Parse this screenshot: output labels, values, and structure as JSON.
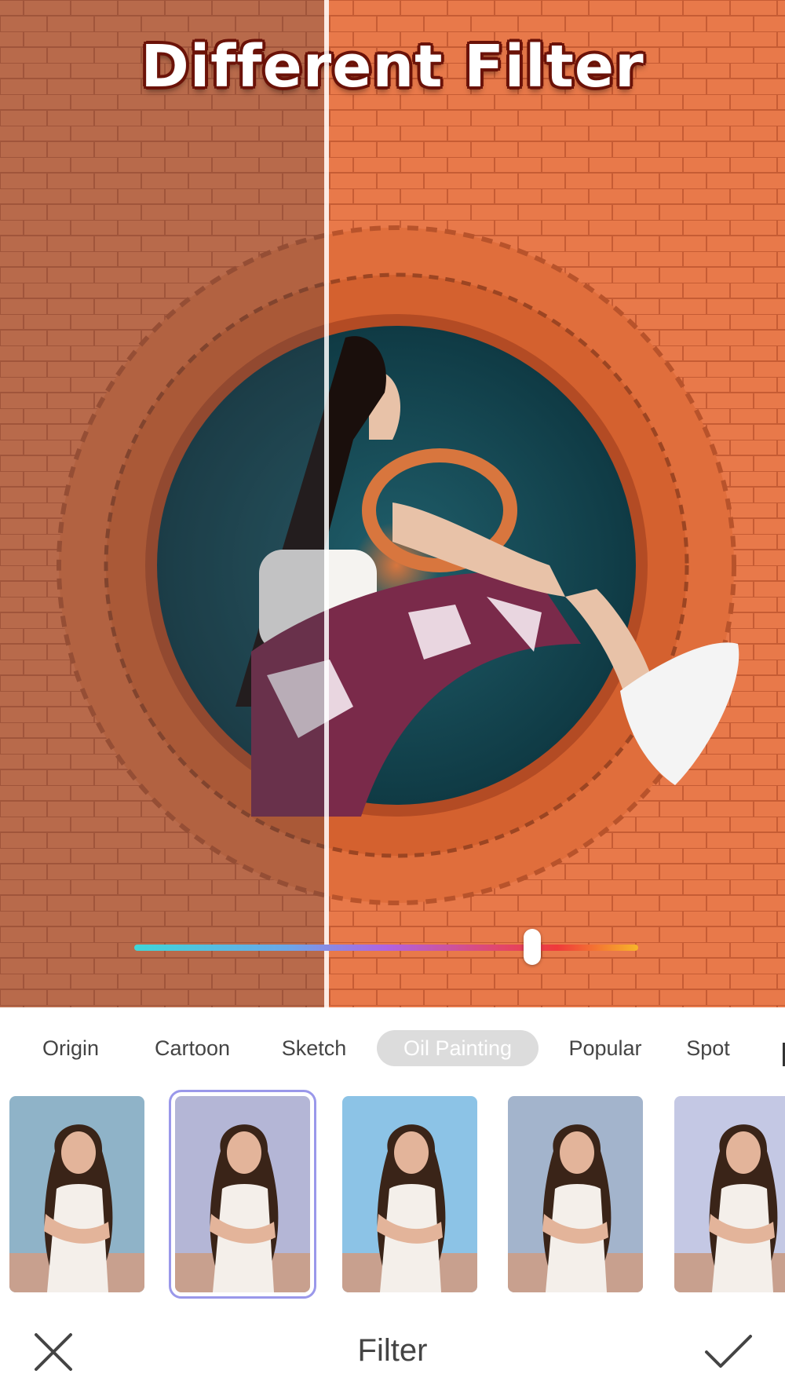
{
  "headline": "Different Filter",
  "slider": {
    "value": 0.79
  },
  "tabs": [
    {
      "label": "Origin",
      "active": false
    },
    {
      "label": "Cartoon",
      "active": false
    },
    {
      "label": "Sketch",
      "active": false
    },
    {
      "label": "Oil Painting",
      "active": true
    },
    {
      "label": "Popular",
      "active": false
    },
    {
      "label": "Spot",
      "active": false
    }
  ],
  "thumbnails": [
    {
      "selected": false,
      "sky": "#8fb3c8"
    },
    {
      "selected": true,
      "sky": "#b4b6d6"
    },
    {
      "selected": false,
      "sky": "#8cc3e6"
    },
    {
      "selected": false,
      "sky": "#a3b4cc"
    },
    {
      "selected": false,
      "sky": "#c4c8e4"
    }
  ],
  "bottom_bar": {
    "title": "Filter",
    "close_icon": "close-icon",
    "confirm_icon": "check-icon"
  },
  "colors": {
    "accent": "#9a98ea",
    "brick": "#e87a46",
    "active_tab": "#dcdcdc"
  }
}
